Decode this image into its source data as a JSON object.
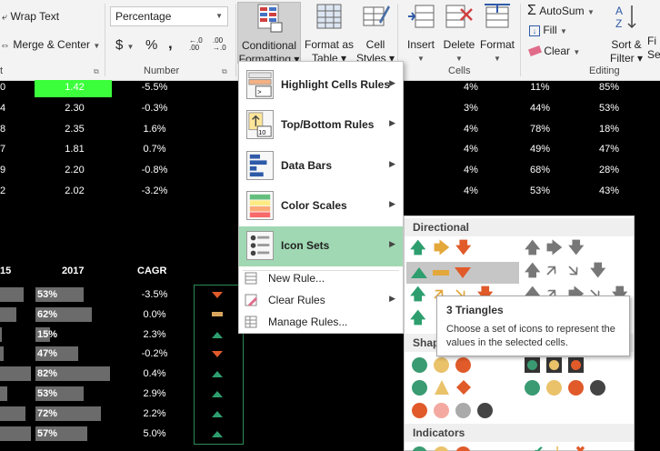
{
  "ribbon": {
    "alignment": {
      "wrap_text": "Wrap Text",
      "merge_center": "Merge & Center"
    },
    "number": {
      "format_value": "Percentage",
      "currency_symbol": "$",
      "percent_symbol": "%",
      "comma_symbol": ",",
      "increase_decimal": "←.0 .00",
      "decrease_decimal": ".00 →.0",
      "group_label": "Number"
    },
    "alignment_group_label": "t",
    "styles": {
      "conditional_formatting": [
        "Conditional",
        "Formatting ▾"
      ],
      "format_as_table": [
        "Format as",
        "Table ▾"
      ],
      "cell_styles": [
        "Cell",
        "Styles ▾"
      ]
    },
    "cells": {
      "insert": "Insert",
      "delete": "Delete",
      "format": "Format",
      "group_label": "Cells"
    },
    "editing": {
      "autosum": "AutoSum",
      "fill": "Fill",
      "clear": "Clear",
      "sort_filter": [
        "Sort &",
        "Filter ▾"
      ],
      "find_select": [
        "Fi",
        "Se"
      ],
      "group_label": "Editing"
    }
  },
  "sheet": {
    "top_rows": [
      {
        "a": "0",
        "b": "1.42",
        "c": "-5.5%",
        "d": "4%",
        "e": "11%",
        "f": "85%"
      },
      {
        "a": "4",
        "b": "2.30",
        "c": "-0.3%",
        "d": "3%",
        "e": "44%",
        "f": "53%"
      },
      {
        "a": "8",
        "b": "2.35",
        "c": "1.6%",
        "d": "4%",
        "e": "78%",
        "f": "18%"
      },
      {
        "a": "7",
        "b": "1.81",
        "c": "0.7%",
        "d": "4%",
        "e": "49%",
        "f": "47%"
      },
      {
        "a": "9",
        "b": "2.20",
        "c": "-0.8%",
        "d": "4%",
        "e": "68%",
        "f": "28%"
      },
      {
        "a": "2",
        "b": "2.02",
        "c": "-3.2%",
        "d": "4%",
        "e": "53%",
        "f": "43%"
      }
    ],
    "headers": {
      "col1": "15",
      "col2": "2017",
      "col3": "CAGR"
    },
    "bottom_rows": [
      {
        "v2017": "53%",
        "bar2017": 0.53,
        "cagr": "-3.5%",
        "icon": "down"
      },
      {
        "v2017": "62%",
        "bar2017": 0.62,
        "cagr": "0.0%",
        "icon": "flat"
      },
      {
        "v2017": "15%",
        "bar2017": 0.15,
        "cagr": "2.3%",
        "icon": "up"
      },
      {
        "v2017": "47%",
        "bar2017": 0.47,
        "cagr": "-0.2%",
        "icon": "down"
      },
      {
        "v2017": "82%",
        "bar2017": 0.82,
        "cagr": "0.4%",
        "icon": "up"
      },
      {
        "v2017": "53%",
        "bar2017": 0.53,
        "cagr": "2.9%",
        "icon": "up"
      },
      {
        "v2017": "72%",
        "bar2017": 0.72,
        "cagr": "2.2%",
        "icon": "up"
      },
      {
        "v2017": "57%",
        "bar2017": 0.57,
        "cagr": "5.0%",
        "icon": "up"
      }
    ]
  },
  "cf_menu": {
    "highlight_rules": "Highlight Cells Rules",
    "top_bottom_rules": "Top/Bottom Rules",
    "data_bars": "Data Bars",
    "color_scales": "Color Scales",
    "icon_sets": "Icon Sets",
    "new_rule": "New Rule...",
    "clear_rules": "Clear Rules",
    "manage_rules": "Manage Rules..."
  },
  "icon_panel": {
    "directional_header": "Directional",
    "shapes_header": "Shap",
    "indicators_header": "Indicators"
  },
  "tooltip": {
    "title": "3 Triangles",
    "description": "Choose a set of icons to represent the values in the selected cells."
  },
  "colors": {
    "green_highlight": "#3cff3c",
    "cf_active": "#a0d8b3",
    "tri_green": "#2e9e6e",
    "tri_red": "#e05a2a",
    "dash_yellow": "#d9a55e"
  }
}
